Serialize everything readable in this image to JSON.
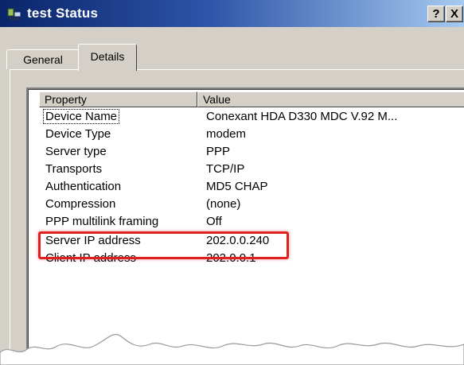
{
  "window": {
    "title": "test Status",
    "help_label": "?",
    "close_label": "X"
  },
  "tabs": [
    {
      "label": "General",
      "active": false
    },
    {
      "label": "Details",
      "active": true
    }
  ],
  "list": {
    "columns": [
      "Property",
      "Value"
    ],
    "rows": [
      {
        "property": "Device Name",
        "value": "Conexant HDA D330 MDC V.92 M..."
      },
      {
        "property": "Device Type",
        "value": "modem"
      },
      {
        "property": "Server type",
        "value": "PPP"
      },
      {
        "property": "Transports",
        "value": "TCP/IP"
      },
      {
        "property": "Authentication",
        "value": "MD5 CHAP"
      },
      {
        "property": "Compression",
        "value": "(none)"
      },
      {
        "property": "PPP multilink framing",
        "value": "Off"
      },
      {
        "property": "Server IP address",
        "value": "202.0.0.240"
      },
      {
        "property": "Client IP address",
        "value": "202.0.0.1"
      }
    ]
  },
  "colors": {
    "highlight": "#e0201c",
    "title_bar": "#0a246a"
  }
}
